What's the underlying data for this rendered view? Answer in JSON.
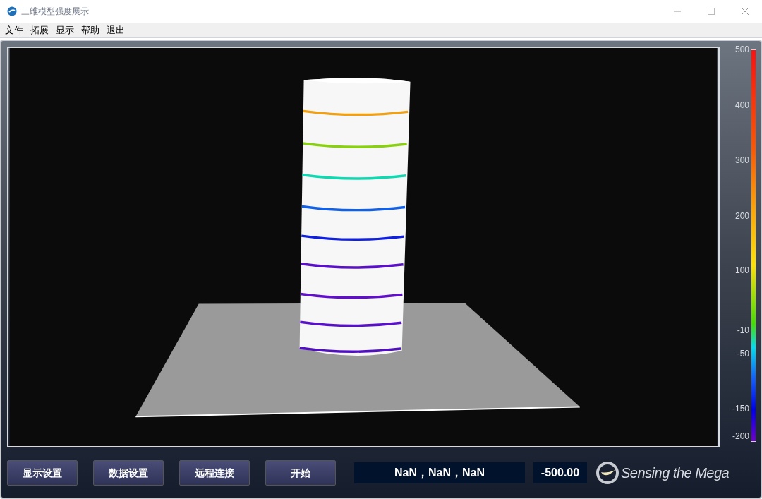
{
  "window": {
    "title": "三维模型强度展示"
  },
  "menu": [
    "文件",
    "拓展",
    "显示",
    "帮助",
    "退出"
  ],
  "color_scale": {
    "ticks": [
      "500",
      "400",
      "300",
      "200",
      "100",
      "-10",
      "-50",
      "-150",
      "-200"
    ]
  },
  "buttons": [
    "显示设置",
    "数据设置",
    "远程连接",
    "开始"
  ],
  "coordinates": "NaN，NaN，NaN",
  "value": "-500.00",
  "logo": {
    "text": "Sensing the Mega"
  }
}
